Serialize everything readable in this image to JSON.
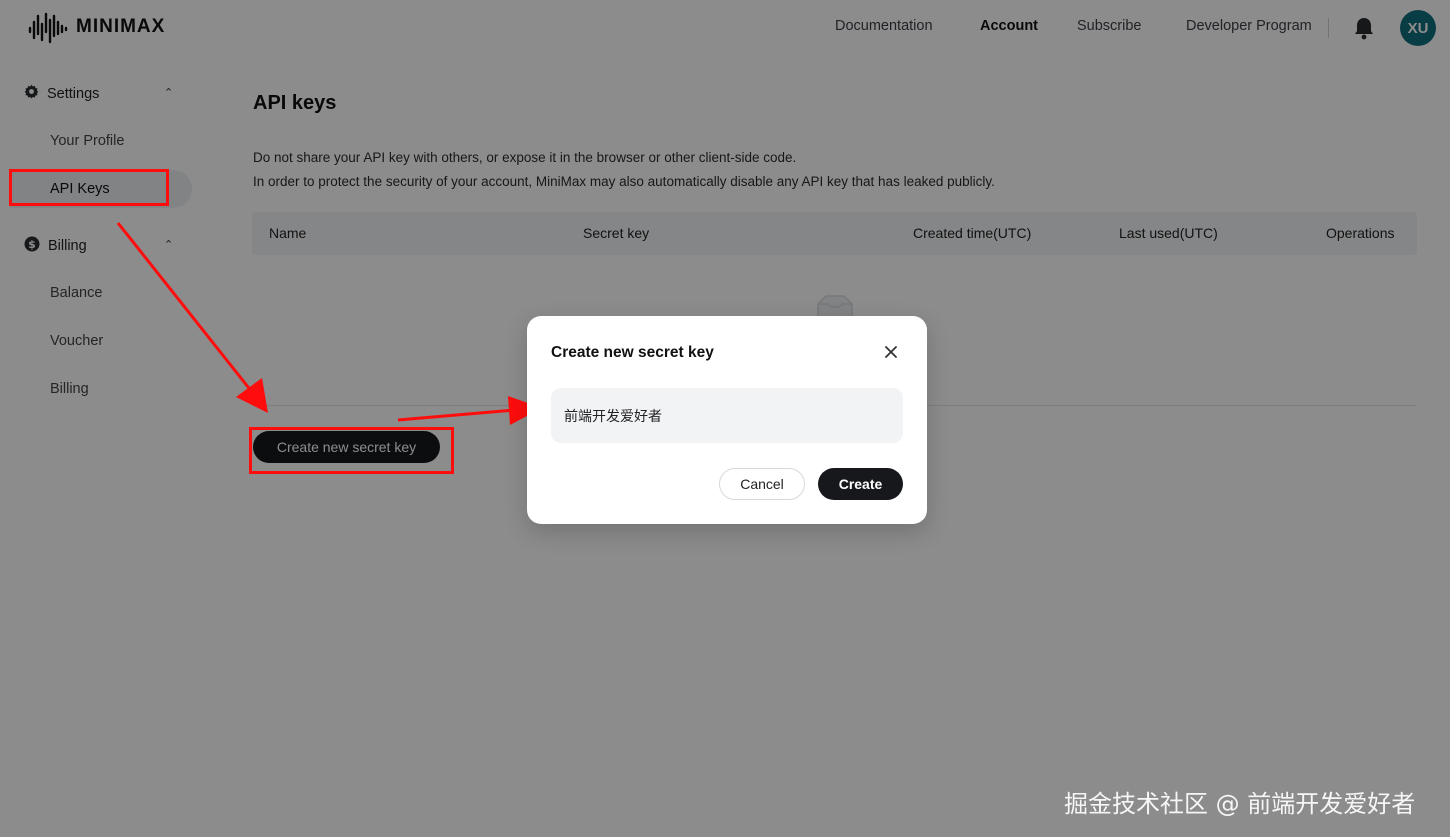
{
  "header": {
    "logo_text": "MINIMAX",
    "nav": [
      "Documentation",
      "Account",
      "Subscribe",
      "Developer Program"
    ],
    "active_nav": "Account",
    "avatar_initials": "XU"
  },
  "sidebar": {
    "settings_label": "Settings",
    "settings_items": [
      "Your Profile",
      "API Keys"
    ],
    "billing_label": "Billing",
    "billing_items": [
      "Balance",
      "Voucher",
      "Billing"
    ],
    "active_item": "API Keys"
  },
  "main": {
    "title": "API keys",
    "desc_line1": "Do not share your API key with others, or expose it in the browser or other client-side code.",
    "desc_line2": "In order to protect the security of your account, MiniMax may also automatically disable any API key that has leaked publicly.",
    "table_headers": [
      "Name",
      "Secret key",
      "Created time(UTC)",
      "Last used(UTC)",
      "Operations"
    ],
    "create_button": "Create new secret key"
  },
  "modal": {
    "title": "Create new secret key",
    "input_value": "前端开发爱好者",
    "cancel_label": "Cancel",
    "create_label": "Create"
  },
  "watermark": "掘金技术社区 @ 前端开发爱好者",
  "colors": {
    "annotation_red": "#ff0c0c",
    "button_dark": "#16181b",
    "avatar_teal": "#12707f"
  }
}
